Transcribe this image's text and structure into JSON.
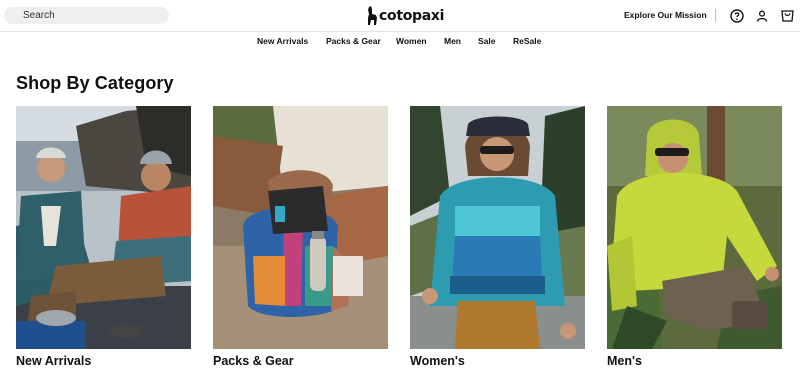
{
  "header": {
    "search_placeholder": "Search",
    "logo_text": "cotopaxi",
    "mission_link": "Explore Our Mission"
  },
  "nav": {
    "items": [
      "New Arrivals",
      "Packs & Gear",
      "Women",
      "Men",
      "Sale",
      "ReSale"
    ]
  },
  "main": {
    "heading": "Shop By Category",
    "categories": [
      {
        "label": "New Arrivals",
        "image": "campfire-couple-photo"
      },
      {
        "label": "Packs & Gear",
        "image": "backpack-photo"
      },
      {
        "label": "Women's",
        "image": "woman-fleece-photo"
      },
      {
        "label": "Men's",
        "image": "man-jacket-photo"
      }
    ]
  },
  "icons": {
    "help": "help-circle-icon",
    "account": "user-icon",
    "cart": "bag-icon",
    "search": "search-icon"
  }
}
